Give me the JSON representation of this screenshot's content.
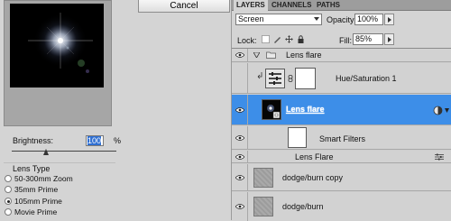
{
  "dialog": {
    "cancel_label": "Cancel",
    "brightness_label": "Brightness:",
    "brightness_value": "100",
    "brightness_unit": "%",
    "brightness_level_fraction": 0.33,
    "lens_type_title": "Lens Type",
    "lens_types": [
      {
        "label": "50-300mm Zoom",
        "checked": false
      },
      {
        "label": "35mm Prime",
        "checked": false
      },
      {
        "label": "105mm Prime",
        "checked": true
      },
      {
        "label": "Movie Prime",
        "checked": false
      }
    ]
  },
  "layers_panel": {
    "tabs": [
      "LAYERS",
      "CHANNELS",
      "PATHS"
    ],
    "blend_mode": "Screen",
    "opacity_label": "Opacity:",
    "opacity_value": "100%",
    "lock_label": "Lock:",
    "fill_label": "Fill:",
    "fill_value": "85%",
    "layers": {
      "group_name": "Lens flare",
      "adjustment_name": "Hue/Saturation 1",
      "smart_object_name": "Lens flare",
      "smart_filters_label": "Smart Filters",
      "filter_name": "Lens Flare",
      "layer_dodge_copy": "dodge/burn copy",
      "layer_dodge": "dodge/burn"
    }
  }
}
